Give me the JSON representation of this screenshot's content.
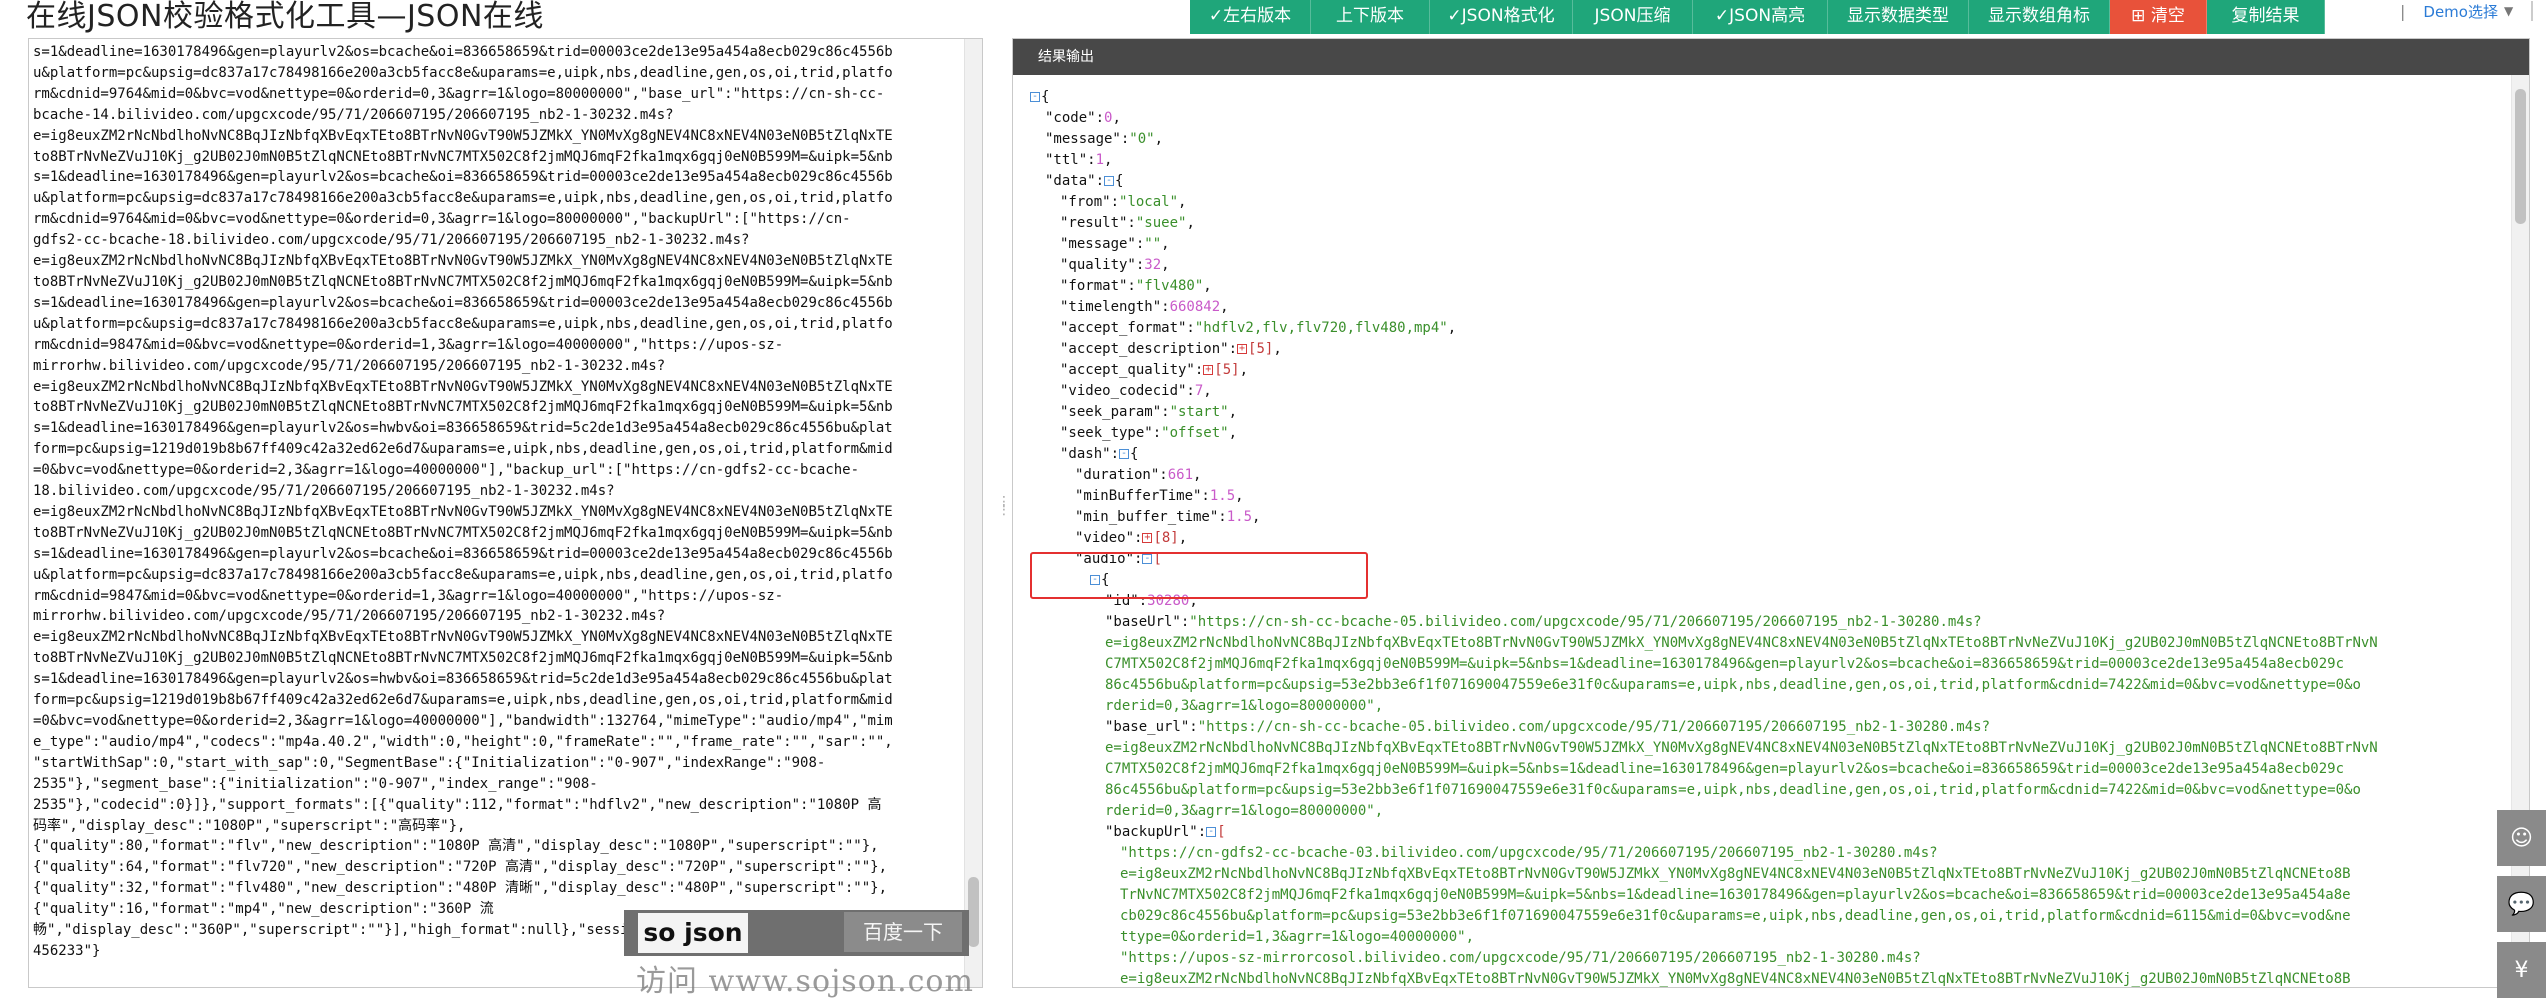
{
  "title": "在线JSON校验格式化工具—JSON在线",
  "toolbar": [
    {
      "label": "✓左右版本",
      "color": "#1fa67a",
      "w": 121
    },
    {
      "label": "上下版本",
      "color": "#1fa67a",
      "w": 119
    },
    {
      "label": "✓JSON格式化",
      "color": "#1fa67a",
      "w": 143
    },
    {
      "label": "JSON压缩",
      "color": "#1fa67a",
      "w": 120
    },
    {
      "label": "✓JSON高亮",
      "color": "#1fa67a",
      "w": 135
    },
    {
      "label": "显示数据类型",
      "color": "#1fa67a",
      "w": 141
    },
    {
      "label": "显示数组角标",
      "color": "#1fa67a",
      "w": 141
    },
    {
      "label": "⊞ 清空",
      "color": "#e8523a",
      "w": 97
    },
    {
      "label": "复制结果",
      "color": "#1fa67a",
      "w": 118
    }
  ],
  "demo": {
    "label": "Demo选择"
  },
  "left": {
    "lines": [
      "s=1&deadline=1630178496&gen=playurlv2&os=bcache&oi=836658659&trid=00003ce2de13e95a454a8ecb029c86c4556b",
      "u&platform=pc&upsig=dc837a17c78498166e200a3cb5facc8e&uparams=e,uipk,nbs,deadline,gen,os,oi,trid,platfo",
      "rm&cdnid=9764&mid=0&bvc=vod&nettype=0&orderid=0,3&agrr=1&logo=80000000\",\"base_url\":\"https://cn-sh-cc-",
      "bcache-14.bilivideo.com/upgcxcode/95/71/206607195/206607195_nb2-1-30232.m4s?",
      "e=ig8euxZM2rNcNbdlhoNvNC8BqJIzNbfqXBvEqxTEto8BTrNvN0GvT90W5JZMkX_YN0MvXg8gNEV4NC8xNEV4N03eN0B5tZlqNxTE",
      "to8BTrNvNeZVuJ10Kj_g2UB02J0mN0B5tZlqNCNEto8BTrNvNC7MTX502C8f2jmMQJ6mqF2fka1mqx6gqj0eN0B599M=&uipk=5&nb",
      "s=1&deadline=1630178496&gen=playurlv2&os=bcache&oi=836658659&trid=00003ce2de13e95a454a8ecb029c86c4556b",
      "u&platform=pc&upsig=dc837a17c78498166e200a3cb5facc8e&uparams=e,uipk,nbs,deadline,gen,os,oi,trid,platfo",
      "rm&cdnid=9764&mid=0&bvc=vod&nettype=0&orderid=0,3&agrr=1&logo=80000000\",\"backupUrl\":[\"https://cn-",
      "gdfs2-cc-bcache-18.bilivideo.com/upgcxcode/95/71/206607195/206607195_nb2-1-30232.m4s?",
      "e=ig8euxZM2rNcNbdlhoNvNC8BqJIzNbfqXBvEqxTEto8BTrNvN0GvT90W5JZMkX_YN0MvXg8gNEV4NC8xNEV4N03eN0B5tZlqNxTE",
      "to8BTrNvNeZVuJ10Kj_g2UB02J0mN0B5tZlqNCNEto8BTrNvNC7MTX502C8f2jmMQJ6mqF2fka1mqx6gqj0eN0B599M=&uipk=5&nb",
      "s=1&deadline=1630178496&gen=playurlv2&os=bcache&oi=836658659&trid=00003ce2de13e95a454a8ecb029c86c4556b",
      "u&platform=pc&upsig=dc837a17c78498166e200a3cb5facc8e&uparams=e,uipk,nbs,deadline,gen,os,oi,trid,platfo",
      "rm&cdnid=9847&mid=0&bvc=vod&nettype=0&orderid=1,3&agrr=1&logo=40000000\",\"https://upos-sz-",
      "mirrorhw.bilivideo.com/upgcxcode/95/71/206607195/206607195_nb2-1-30232.m4s?",
      "e=ig8euxZM2rNcNbdlhoNvNC8BqJIzNbfqXBvEqxTEto8BTrNvN0GvT90W5JZMkX_YN0MvXg8gNEV4NC8xNEV4N03eN0B5tZlqNxTE",
      "to8BTrNvNeZVuJ10Kj_g2UB02J0mN0B5tZlqNCNEto8BTrNvNC7MTX502C8f2jmMQJ6mqF2fka1mqx6gqj0eN0B599M=&uipk=5&nb",
      "s=1&deadline=1630178496&gen=playurlv2&os=hwbv&oi=836658659&trid=5c2de1d3e95a454a8ecb029c86c4556bu&plat",
      "form=pc&upsig=1219d019b8b67ff409c42a32ed62e6d7&uparams=e,uipk,nbs,deadline,gen,os,oi,trid,platform&mid",
      "=0&bvc=vod&nettype=0&orderid=2,3&agrr=1&logo=40000000\"],\"backup_url\":[\"https://cn-gdfs2-cc-bcache-",
      "18.bilivideo.com/upgcxcode/95/71/206607195/206607195_nb2-1-30232.m4s?",
      "e=ig8euxZM2rNcNbdlhoNvNC8BqJIzNbfqXBvEqxTEto8BTrNvN0GvT90W5JZMkX_YN0MvXg8gNEV4NC8xNEV4N03eN0B5tZlqNxTE",
      "to8BTrNvNeZVuJ10Kj_g2UB02J0mN0B5tZlqNCNEto8BTrNvNC7MTX502C8f2jmMQJ6mqF2fka1mqx6gqj0eN0B599M=&uipk=5&nb",
      "s=1&deadline=1630178496&gen=playurlv2&os=bcache&oi=836658659&trid=00003ce2de13e95a454a8ecb029c86c4556b",
      "u&platform=pc&upsig=dc837a17c78498166e200a3cb5facc8e&uparams=e,uipk,nbs,deadline,gen,os,oi,trid,platfo",
      "rm&cdnid=9847&mid=0&bvc=vod&nettype=0&orderid=1,3&agrr=1&logo=40000000\",\"https://upos-sz-",
      "mirrorhw.bilivideo.com/upgcxcode/95/71/206607195/206607195_nb2-1-30232.m4s?",
      "e=ig8euxZM2rNcNbdlhoNvNC8BqJIzNbfqXBvEqxTEto8BTrNvN0GvT90W5JZMkX_YN0MvXg8gNEV4NC8xNEV4N03eN0B5tZlqNxTE",
      "to8BTrNvNeZVuJ10Kj_g2UB02J0mN0B5tZlqNCNEto8BTrNvNC7MTX502C8f2jmMQJ6mqF2fka1mqx6gqj0eN0B599M=&uipk=5&nb",
      "s=1&deadline=1630178496&gen=playurlv2&os=hwbv&oi=836658659&trid=5c2de1d3e95a454a8ecb029c86c4556bu&plat",
      "form=pc&upsig=1219d019b8b67ff409c42a32ed62e6d7&uparams=e,uipk,nbs,deadline,gen,os,oi,trid,platform&mid",
      "=0&bvc=vod&nettype=0&orderid=2,3&agrr=1&logo=40000000\"],\"bandwidth\":132764,\"mimeType\":\"audio/mp4\",\"mim",
      "e_type\":\"audio/mp4\",\"codecs\":\"mp4a.40.2\",\"width\":0,\"height\":0,\"frameRate\":\"\",\"frame_rate\":\"\",\"sar\":\"\",",
      "\"startWithSap\":0,\"start_with_sap\":0,\"SegmentBase\":{\"Initialization\":\"0-907\",\"indexRange\":\"908-",
      "2535\"},\"segment_base\":{\"initialization\":\"0-907\",\"index_range\":\"908-",
      "2535\"},\"codecid\":0}]},\"support_formats\":[{\"quality\":112,\"format\":\"hdflv2\",\"new_description\":\"1080P 高",
      "码率\",\"display_desc\":\"1080P\",\"superscript\":\"高码率\"},",
      "{\"quality\":80,\"format\":\"flv\",\"new_description\":\"1080P 高清\",\"display_desc\":\"1080P\",\"superscript\":\"\"},",
      "{\"quality\":64,\"format\":\"flv720\",\"new_description\":\"720P 高清\",\"display_desc\":\"720P\",\"superscript\":\"\"},",
      "{\"quality\":32,\"format\":\"flv480\",\"new_description\":\"480P 清晰\",\"display_desc\":\"480P\",\"superscript\":\"\"},",
      "{\"quality\":16,\"format\":\"mp4\",\"new_description\":\"360P 流",
      "畅\",\"display_desc\":\"360P\",\"superscript\":\"\"}],\"high_format\":null},\"session\":\"c0333d712c8f874e475adeee3",
      "456233\"}"
    ]
  },
  "watermark": {
    "logo": "so json",
    "button": "百度一下",
    "url": "访问 www.sojson.com"
  },
  "right": {
    "header": "结果输出",
    "tree": [
      {
        "i": 0,
        "p": [
          [
            "t",
            "-"
          ],
          [
            "b",
            "{"
          ]
        ]
      },
      {
        "i": 1,
        "p": [
          [
            "k",
            "\"code\":"
          ],
          [
            "n",
            "0"
          ],
          [
            "k",
            ","
          ]
        ]
      },
      {
        "i": 1,
        "p": [
          [
            "k",
            "\"message\":"
          ],
          [
            "s",
            "\"0\""
          ],
          [
            "k",
            ","
          ]
        ]
      },
      {
        "i": 1,
        "p": [
          [
            "k",
            "\"ttl\":"
          ],
          [
            "n",
            "1"
          ],
          [
            "k",
            ","
          ]
        ]
      },
      {
        "i": 1,
        "p": [
          [
            "k",
            "\"data\":"
          ],
          [
            "t",
            "-"
          ],
          [
            "b",
            "{"
          ]
        ]
      },
      {
        "i": 2,
        "p": [
          [
            "k",
            "\"from\":"
          ],
          [
            "s",
            "\"local\""
          ],
          [
            "k",
            ","
          ]
        ]
      },
      {
        "i": 2,
        "p": [
          [
            "k",
            "\"result\":"
          ],
          [
            "s",
            "\"suee\""
          ],
          [
            "k",
            ","
          ]
        ]
      },
      {
        "i": 2,
        "p": [
          [
            "k",
            "\"message\":"
          ],
          [
            "s",
            "\"\""
          ],
          [
            "k",
            ","
          ]
        ]
      },
      {
        "i": 2,
        "p": [
          [
            "k",
            "\"quality\":"
          ],
          [
            "n",
            "32"
          ],
          [
            "k",
            ","
          ]
        ]
      },
      {
        "i": 2,
        "p": [
          [
            "k",
            "\"format\":"
          ],
          [
            "s",
            "\"flv480\""
          ],
          [
            "k",
            ","
          ]
        ]
      },
      {
        "i": 2,
        "p": [
          [
            "k",
            "\"timelength\":"
          ],
          [
            "n",
            "660842"
          ],
          [
            "k",
            ","
          ]
        ]
      },
      {
        "i": 2,
        "p": [
          [
            "k",
            "\"accept_format\":"
          ],
          [
            "s",
            "\"hdflv2,flv,flv720,flv480,mp4\""
          ],
          [
            "k",
            ","
          ]
        ]
      },
      {
        "i": 2,
        "p": [
          [
            "k",
            "\"accept_description\":"
          ],
          [
            "t",
            "+"
          ],
          [
            "c",
            "[5]"
          ],
          [
            "k",
            ","
          ]
        ]
      },
      {
        "i": 2,
        "p": [
          [
            "k",
            "\"accept_quality\":"
          ],
          [
            "t",
            "+"
          ],
          [
            "c",
            "[5]"
          ],
          [
            "k",
            ","
          ]
        ]
      },
      {
        "i": 2,
        "p": [
          [
            "k",
            "\"video_codecid\":"
          ],
          [
            "n",
            "7"
          ],
          [
            "k",
            ","
          ]
        ]
      },
      {
        "i": 2,
        "p": [
          [
            "k",
            "\"seek_param\":"
          ],
          [
            "s",
            "\"start\""
          ],
          [
            "k",
            ","
          ]
        ]
      },
      {
        "i": 2,
        "p": [
          [
            "k",
            "\"seek_type\":"
          ],
          [
            "s",
            "\"offset\""
          ],
          [
            "k",
            ","
          ]
        ]
      },
      {
        "i": 2,
        "p": [
          [
            "k",
            "\"dash\":"
          ],
          [
            "t",
            "-"
          ],
          [
            "b",
            "{"
          ]
        ]
      },
      {
        "i": 3,
        "p": [
          [
            "k",
            "\"duration\":"
          ],
          [
            "n",
            "661"
          ],
          [
            "k",
            ","
          ]
        ]
      },
      {
        "i": 3,
        "p": [
          [
            "k",
            "\"minBufferTime\":"
          ],
          [
            "n",
            "1.5"
          ],
          [
            "k",
            ","
          ]
        ]
      },
      {
        "i": 3,
        "p": [
          [
            "k",
            "\"min_buffer_time\":"
          ],
          [
            "n",
            "1.5"
          ],
          [
            "k",
            ","
          ]
        ]
      },
      {
        "i": 3,
        "p": [
          [
            "k",
            "\"video\":"
          ],
          [
            "t",
            "+"
          ],
          [
            "c",
            "[8]"
          ],
          [
            "k",
            ","
          ]
        ]
      },
      {
        "i": 3,
        "p": [
          [
            "k",
            "\"audio\":"
          ],
          [
            "t",
            "-"
          ],
          [
            "r",
            "["
          ]
        ]
      },
      {
        "i": 4,
        "p": [
          [
            "t",
            "-"
          ],
          [
            "b",
            "{"
          ]
        ]
      },
      {
        "i": 5,
        "p": [
          [
            "k",
            "\"id\":"
          ],
          [
            "n",
            "30280"
          ],
          [
            "k",
            ","
          ]
        ]
      },
      {
        "i": 5,
        "p": [
          [
            "k",
            "\"baseUrl\":"
          ],
          [
            "s",
            "\"https://cn-sh-cc-bcache-05.bilivideo.com/upgcxcode/95/71/206607195/206607195_nb2-1-30280.m4s?"
          ]
        ]
      },
      {
        "i": 5,
        "w": [
          "e=ig8euxZM2rNcNbdlhoNvNC8BqJIzNbfqXBvEqxTEto8BTrNvN0GvT90W5JZMkX_YN0MvXg8gNEV4NC8xNEV4N03eN0B5tZlqNxTEto8BTrNvNeZVuJ10Kj_g2UB02J0mN0B5tZlqNCNEto8BTrNvN",
          "C7MTX502C8f2jmMQJ6mqF2fka1mqx6gqj0eN0B599M=&uipk=5&nbs=1&deadline=1630178496&gen=playurlv2&os=bcache&oi=836658659&trid=00003ce2de13e95a454a8ecb029c",
          "86c4556bu&platform=pc&upsig=53e2bb3e6f1f071690047559e6e31f0c&uparams=e,uipk,nbs,deadline,gen,os,oi,trid,platform&cdnid=7422&mid=0&bvc=vod&nettype=0&o",
          "rderid=0,3&agrr=1&logo=80000000\","
        ]
      },
      {
        "i": 5,
        "p": [
          [
            "k",
            "\"base_url\":"
          ],
          [
            "s",
            "\"https://cn-sh-cc-bcache-05.bilivideo.com/upgcxcode/95/71/206607195/206607195_nb2-1-30280.m4s?"
          ]
        ]
      },
      {
        "i": 5,
        "w": [
          "e=ig8euxZM2rNcNbdlhoNvNC8BqJIzNbfqXBvEqxTEto8BTrNvN0GvT90W5JZMkX_YN0MvXg8gNEV4NC8xNEV4N03eN0B5tZlqNxTEto8BTrNvNeZVuJ10Kj_g2UB02J0mN0B5tZlqNCNEto8BTrNvN",
          "C7MTX502C8f2jmMQJ6mqF2fka1mqx6gqj0eN0B599M=&uipk=5&nbs=1&deadline=1630178496&gen=playurlv2&os=bcache&oi=836658659&trid=00003ce2de13e95a454a8ecb029c",
          "86c4556bu&platform=pc&upsig=53e2bb3e6f1f071690047559e6e31f0c&uparams=e,uipk,nbs,deadline,gen,os,oi,trid,platform&cdnid=7422&mid=0&bvc=vod&nettype=0&o",
          "rderid=0,3&agrr=1&logo=80000000\","
        ]
      },
      {
        "i": 5,
        "p": [
          [
            "k",
            "\"backupUrl\":"
          ],
          [
            "t",
            "-"
          ],
          [
            "r",
            "["
          ]
        ]
      },
      {
        "i": 6,
        "p": [
          [
            "s",
            "\"https://cn-gdfs2-cc-bcache-03.bilivideo.com/upgcxcode/95/71/206607195/206607195_nb2-1-30280.m4s?"
          ]
        ]
      },
      {
        "i": 6,
        "w": [
          "e=ig8euxZM2rNcNbdlhoNvNC8BqJIzNbfqXBvEqxTEto8BTrNvN0GvT90W5JZMkX_YN0MvXg8gNEV4NC8xNEV4N03eN0B5tZlqNxTEto8BTrNvNeZVuJ10Kj_g2UB02J0mN0B5tZlqNCNEto8B",
          "TrNvNC7MTX502C8f2jmMQJ6mqF2fka1mqx6gqj0eN0B599M=&uipk=5&nbs=1&deadline=1630178496&gen=playurlv2&os=bcache&oi=836658659&trid=00003ce2de13e95a454a8e",
          "cb029c86c4556bu&platform=pc&upsig=53e2bb3e6f1f071690047559e6e31f0c&uparams=e,uipk,nbs,deadline,gen,os,oi,trid,platform&cdnid=6115&mid=0&bvc=vod&ne",
          "ttype=0&orderid=1,3&agrr=1&logo=40000000\","
        ]
      },
      {
        "i": 6,
        "p": [
          [
            "s",
            "\"https://upos-sz-mirrorcosol.bilivideo.com/upgcxcode/95/71/206607195/206607195_nb2-1-30280.m4s?"
          ]
        ]
      },
      {
        "i": 6,
        "w": [
          "e=ig8euxZM2rNcNbdlhoNvNC8BqJIzNbfqXBvEqxTEto8BTrNvN0GvT90W5JZMkX_YN0MvXg8gNEV4NC8xNEV4N03eN0B5tZlqNxTEto8BTrNvNeZVuJ10Kj_g2UB02J0mN0B5tZlqNCNEto8B"
        ]
      }
    ]
  },
  "side_tools": [
    {
      "name": "face-icon",
      "glyph": "☺"
    },
    {
      "name": "chat-icon",
      "glyph": "💬"
    },
    {
      "name": "yen-icon",
      "glyph": "¥"
    }
  ]
}
